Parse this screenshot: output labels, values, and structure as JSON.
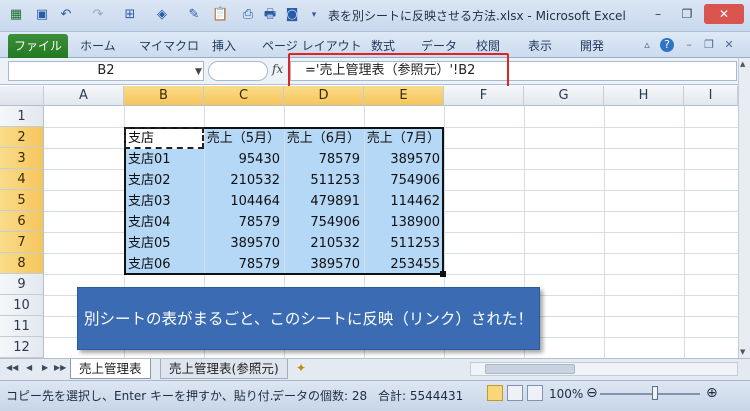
{
  "window": {
    "title": "表を別シートに反映させる方法.xlsx - Microsoft Excel",
    "controls": {
      "minimize": "–",
      "restore": "❐",
      "close": "✕"
    }
  },
  "quick_access": [
    "save-icon",
    "undo-icon",
    "redo-icon",
    "border-icon",
    "fill-color-icon",
    "format-painter-icon",
    "paste-icon",
    "print-icon",
    "camera-icon"
  ],
  "ribbon": {
    "tabs": [
      "ファイル",
      "ホーム",
      "マイマクロ",
      "挿入",
      "ページ レイアウト",
      "数式",
      "データ",
      "校閲",
      "表示",
      "開発"
    ]
  },
  "formula_bar": {
    "name_box": "B2",
    "fx_label": "fx",
    "formula": "='売上管理表（参照元）'!B2"
  },
  "grid": {
    "columns": [
      "A",
      "B",
      "C",
      "D",
      "E",
      "F",
      "G",
      "H",
      "I"
    ],
    "selected_columns": [
      "B",
      "C",
      "D",
      "E"
    ],
    "rows": [
      "1",
      "2",
      "3",
      "4",
      "5",
      "6",
      "7",
      "8",
      "9",
      "10",
      "11",
      "12"
    ],
    "selected_rows": [
      "2",
      "3",
      "4",
      "5",
      "6",
      "7",
      "8"
    ],
    "table": {
      "header": [
        "支店",
        "売上（5月）",
        "売上（6月）",
        "売上（7月）"
      ],
      "rows": [
        [
          "支店01",
          "95430",
          "78579",
          "389570"
        ],
        [
          "支店02",
          "210532",
          "511253",
          "754906"
        ],
        [
          "支店03",
          "104464",
          "479891",
          "114462"
        ],
        [
          "支店04",
          "78579",
          "754906",
          "138900"
        ],
        [
          "支店05",
          "389570",
          "210532",
          "511253"
        ],
        [
          "支店06",
          "78579",
          "389570",
          "253455"
        ]
      ]
    }
  },
  "callout": "別シートの表がまるごと、このシートに反映（リンク）された！",
  "sheets": {
    "tabs": [
      "売上管理表",
      "売上管理表(参照元)"
    ],
    "active": 0
  },
  "status": {
    "message": "コピー先を選択し、Enter キーを押すか、貼り付...",
    "count_label": "データの個数: 28",
    "sum_label": "合計: 5544431",
    "zoom": "100%",
    "zoom_minus": "⊖",
    "zoom_plus": "⊕"
  }
}
